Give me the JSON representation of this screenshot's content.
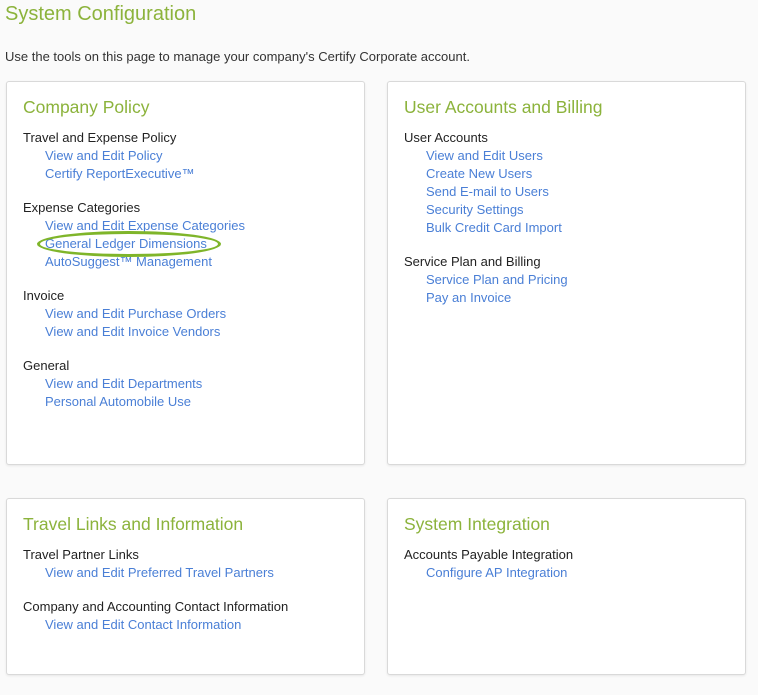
{
  "page": {
    "title": "System Configuration",
    "intro": "Use the tools on this page to manage your company's Certify Corporate account."
  },
  "panels": [
    {
      "title": "Company Policy",
      "sections": [
        {
          "heading": "Travel and Expense Policy",
          "links": [
            "View and Edit Policy",
            "Certify ReportExecutive™"
          ]
        },
        {
          "heading": "Expense Categories",
          "links": [
            "View and Edit Expense Categories",
            "General Ledger Dimensions",
            "AutoSuggest™ Management"
          ]
        },
        {
          "heading": "Invoice",
          "links": [
            "View and Edit Purchase Orders",
            "View and Edit Invoice Vendors"
          ]
        },
        {
          "heading": "General",
          "links": [
            "View and Edit Departments",
            "Personal Automobile Use"
          ]
        }
      ]
    },
    {
      "title": "User Accounts and Billing",
      "sections": [
        {
          "heading": "User Accounts",
          "links": [
            "View and Edit Users",
            "Create New Users",
            "Send E-mail to Users",
            "Security Settings",
            "Bulk Credit Card Import"
          ]
        },
        {
          "heading": "Service Plan and Billing",
          "links": [
            "Service Plan and Pricing",
            "Pay an Invoice"
          ]
        }
      ]
    },
    {
      "title": "Travel Links and Information",
      "sections": [
        {
          "heading": "Travel Partner Links",
          "links": [
            "View and Edit Preferred Travel Partners"
          ]
        },
        {
          "heading": "Company and Accounting Contact Information",
          "links": [
            "View and Edit Contact Information"
          ]
        }
      ]
    },
    {
      "title": "System Integration",
      "sections": [
        {
          "heading": "Accounts Payable Integration",
          "links": [
            "Configure AP Integration"
          ]
        }
      ]
    }
  ],
  "highlight": {
    "panel": 0,
    "section": 1,
    "link": 1
  },
  "colors": {
    "accent": "#8cb33c",
    "link": "#4a7fd6",
    "highlight": "#7fb52a"
  }
}
